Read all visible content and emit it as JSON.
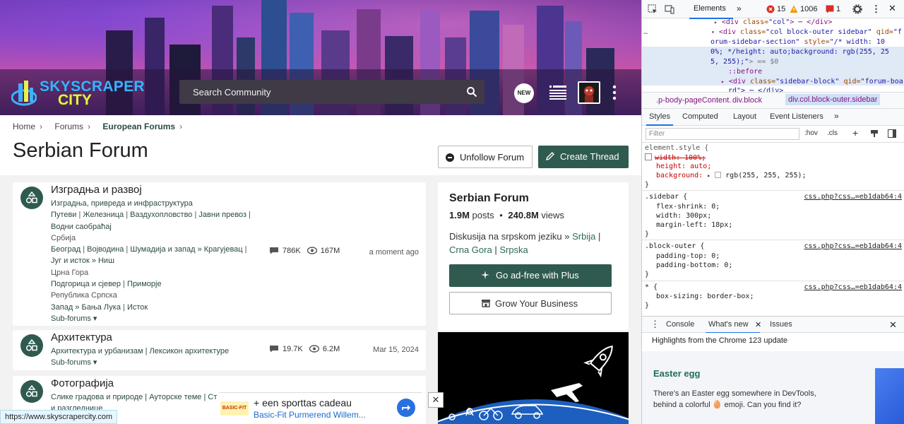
{
  "site": {
    "logo": {
      "line1": "SKYSCRAPER",
      "line2": "CITY"
    },
    "search": {
      "placeholder": "Search Community"
    },
    "header": {
      "new_badge": "NEW"
    },
    "breadcrumb": [
      {
        "label": "Home"
      },
      {
        "label": "Forums"
      },
      {
        "label": "European Forums"
      }
    ],
    "page_title": "Serbian Forum",
    "buttons": {
      "unfollow": "Unfollow Forum",
      "create_thread": "Create Thread"
    },
    "forums": [
      {
        "title": "Изградња и развој",
        "subtitle": "Изградња, привреда и инфраструктура",
        "lines": [
          {
            "type": "links",
            "items": [
              "Путеви",
              "Железница",
              "Ваздухопловство",
              "Јавни превоз"
            ]
          },
          {
            "type": "links",
            "items": [
              "Водни саобраћај"
            ]
          },
          {
            "type": "gray",
            "text": "Србија"
          },
          {
            "type": "links",
            "items": [
              "Београд",
              "Војводина",
              "Шумадија и запад » Крагујевац"
            ]
          },
          {
            "type": "links",
            "items": [
              "Југ и исток » Ниш"
            ]
          },
          {
            "type": "gray",
            "text": "Црна Гора"
          },
          {
            "type": "links",
            "items": [
              "Подгорица и сјевер",
              "Приморје"
            ]
          },
          {
            "type": "gray",
            "text": "Република Српска"
          },
          {
            "type": "links",
            "items": [
              "Запад » Бања Лука",
              "Исток"
            ]
          }
        ],
        "subforums": "Sub-forums ▾",
        "posts": "786K",
        "views": "167M",
        "last": "a moment ago"
      },
      {
        "title": "Архитектура",
        "subtitle": "Архитектура и урбанизам | Лексикон архитектуре",
        "subforums": "Sub-forums ▾",
        "posts": "19.7K",
        "views": "6.2M",
        "last": "Mar 15, 2024"
      },
      {
        "title": "Фотографија",
        "subtitle": "Слике градова и природе | Ауторске теме | Ст",
        "line2": "и разгледнице"
      }
    ],
    "sidebar": {
      "title": "Serbian Forum",
      "posts_count": "1.9M",
      "posts_label": "posts",
      "views_count": "240.8M",
      "views_label": "views",
      "desc_prefix": "Diskusija na srpskom jeziku »",
      "desc_links": [
        "Srbija",
        "Crna Gora",
        "Srpska"
      ],
      "adfree_button": "Go ad-free with Plus",
      "grow_button": "Grow Your Business"
    },
    "status_url": "https://www.skyscrapercity.com",
    "ad": {
      "logo": "BASIC-FIT",
      "line1": "+ een sporttas cadeau",
      "line2": "Basic-Fit Purmerend Willem...",
      "close": "✕"
    }
  },
  "devtools": {
    "top_tab": "Elements",
    "errors": "15",
    "warnings": "1006",
    "issues": "1",
    "tree": {
      "l1_tag": "<div",
      "l1_attr": "class=",
      "l1_val": "\"col\"",
      "l1_end": "> ⋯ </div>",
      "l2_a": "<div",
      "l2_b": "class=",
      "l2_c": "\"col block-outer sidebar\"",
      "l2_d": "qid=",
      "l2_e": "\"f",
      "l3": "orum-sidebar-section\"",
      "l3_b": "style=",
      "l3_c": "\"/* width: 10",
      "l4": "0%; */height: auto;background: rgb(255, 25",
      "l5": "5, 255);\"",
      "l5_b": "> == $0",
      "l6": "::before",
      "l7_a": "<div",
      "l7_b": "class=",
      "l7_c": "\"sidebar-block\"",
      "l7_d": "qid=",
      "l7_e": "\"forum-boa",
      "l8": "rd\"> ⋯ </div>"
    },
    "crumbs": [
      ".p-body-pageContent.",
      "div.block",
      "div.col.block-outer.sidebar"
    ],
    "tabs": [
      "Styles",
      "Computed",
      "Layout",
      "Event Listeners"
    ],
    "filter_placeholder": "Filter",
    "hov": ":hov",
    "cls": ".cls",
    "rules": {
      "r0_sel": "element.style {",
      "r0_p1": "width: 100%;",
      "r0_p2": "height: auto;",
      "r0_p3": "background:",
      "r0_p3v": "rgb(255, 255, 255);",
      "close": "}",
      "r1_sel": ".sidebar {",
      "r1_src": "css.php?css…=eb1dab64:4",
      "r1_p1": "flex-shrink: 0;",
      "r1_p2": "width: 300px;",
      "r1_p3": "margin-left: 18px;",
      "r2_sel": ".block-outer {",
      "r2_src": "css.php?css…=eb1dab64:4",
      "r2_p1": "padding-top: 0;",
      "r2_p2": "padding-bottom: 0;",
      "r3_sel": "* {",
      "r3_src": "css.php?css…=eb1dab64:4",
      "r3_p1": "box-sizing: border-box;"
    },
    "bottom_tabs": [
      "Console",
      "What's new",
      "Issues"
    ],
    "whatsnew": {
      "highlight": "Highlights from the Chrome 123 update",
      "heading": "Easter egg",
      "para": "There's an Easter egg somewhere in DevTools, behind a colorful 🥚 emoji. Can you find it?"
    }
  }
}
